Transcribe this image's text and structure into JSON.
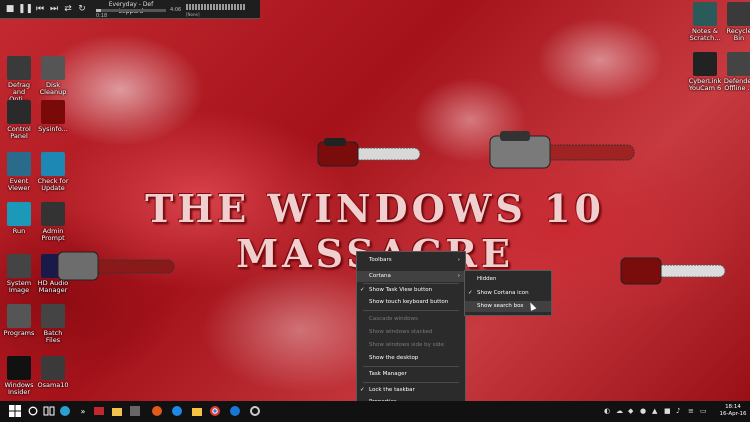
{
  "media_player": {
    "track": "Everyday - Def Leppard",
    "time_elapsed": "0:18",
    "time_total": "4:06",
    "progress": 0.07,
    "volume_label": "[None]"
  },
  "desktop_icons_left": [
    {
      "label": "Defrag and Opti...",
      "icon": "defrag-icon",
      "color": "#3a3a3a"
    },
    {
      "label": "Disk Cleanup",
      "icon": "disk-cleanup-icon",
      "color": "#555"
    },
    {
      "label": "Control Panel",
      "icon": "control-panel-icon",
      "color": "#2a2a2a"
    },
    {
      "label": "Sysinfo...",
      "icon": "gear-icon",
      "color": "#7a0a0a"
    },
    {
      "label": "Event Viewer",
      "icon": "event-viewer-icon",
      "color": "#2a6a8a"
    },
    {
      "label": "Check for Update",
      "icon": "update-icon",
      "color": "#1e88b4"
    },
    {
      "label": "Run",
      "icon": "run-icon",
      "color": "#1a9ab8"
    },
    {
      "label": "Admin Prompt",
      "icon": "command-prompt-icon",
      "color": "#333"
    },
    {
      "label": "System Image",
      "icon": "system-image-icon",
      "color": "#444"
    },
    {
      "label": "HD Audio Manager",
      "icon": "audio-manager-icon",
      "color": "#1a1a4a"
    },
    {
      "label": "Programs",
      "icon": "programs-icon",
      "color": "#555"
    },
    {
      "label": "Batch Files",
      "icon": "batch-files-icon",
      "color": "#444"
    },
    {
      "label": "Windows Insider",
      "icon": "windows-insider-icon",
      "color": "#111"
    },
    {
      "label": "Osama10",
      "icon": "osama-icon",
      "color": "#3a3a3a"
    }
  ],
  "desktop_icons_right": [
    {
      "label": "Notes & Scratch...",
      "icon": "notes-icon",
      "color": "#2b5a5a"
    },
    {
      "label": "Recycle Bin",
      "icon": "recycle-bin-icon",
      "color": "#3a3a3a"
    },
    {
      "label": "CyberLink YouCam 6",
      "icon": "youcam-icon",
      "color": "#222"
    },
    {
      "label": "Defender Offline ...",
      "icon": "defender-icon",
      "color": "#444"
    }
  ],
  "wallpaper_title": "THE WINDOWS 10 MASSACRE",
  "context_menu": {
    "items": [
      {
        "label": "Toolbars",
        "checked": false,
        "submenu": true,
        "disabled": false
      },
      {
        "label": "Cortana",
        "checked": false,
        "submenu": true,
        "disabled": false,
        "highlighted": true
      },
      {
        "label": "Show Task View button",
        "checked": true,
        "submenu": false,
        "disabled": false
      },
      {
        "label": "Show touch keyboard button",
        "checked": false,
        "submenu": false,
        "disabled": false
      },
      {
        "label": "Cascade windows",
        "checked": false,
        "submenu": false,
        "disabled": true
      },
      {
        "label": "Show windows stacked",
        "checked": false,
        "submenu": false,
        "disabled": true
      },
      {
        "label": "Show windows side by side",
        "checked": false,
        "submenu": false,
        "disabled": true
      },
      {
        "label": "Show the desktop",
        "checked": false,
        "submenu": false,
        "disabled": false
      },
      {
        "label": "Task Manager",
        "checked": false,
        "submenu": false,
        "disabled": false
      },
      {
        "label": "Lock the taskbar",
        "checked": true,
        "submenu": false,
        "disabled": false
      },
      {
        "label": "Properties",
        "checked": false,
        "submenu": false,
        "disabled": false
      }
    ],
    "check_mark": "✓",
    "submenu_arrow": "›"
  },
  "cortana_submenu": {
    "items": [
      {
        "label": "Hidden",
        "checked": false
      },
      {
        "label": "Show Cortana icon",
        "checked": true
      },
      {
        "label": "Show search box",
        "checked": false,
        "highlighted": true
      }
    ]
  },
  "taskbar": {
    "pinned": [
      "start-icon",
      "cortana-icon",
      "task-view-icon",
      "media-player-icon",
      "chevron-icon",
      "taskbar-app-icon",
      "file-explorer-icon",
      "store-icon",
      "media-center-icon",
      "ie-icon",
      "chrome-icon",
      "edge-icon",
      "folder-icon",
      "settings-icon"
    ],
    "clock_time": "18:14",
    "clock_date": "16-Apr-16"
  },
  "colors": {
    "accent_red": "#b3141c",
    "menu_bg": "#2b2b2b",
    "taskbar_bg": "#111111"
  }
}
